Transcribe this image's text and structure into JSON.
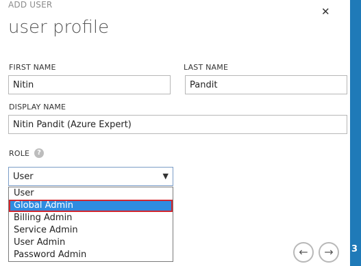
{
  "dialog": {
    "header": "ADD USER",
    "title": "user profile",
    "close_icon": "close-icon"
  },
  "form": {
    "first_name": {
      "label": "FIRST NAME",
      "value": "Nitin"
    },
    "last_name": {
      "label": "LAST NAME",
      "value": "Pandit"
    },
    "display_name": {
      "label": "DISPLAY NAME",
      "value": "Nitin Pandit (Azure Expert)"
    },
    "role": {
      "label": "ROLE",
      "help_icon": "help-icon",
      "selected": "User",
      "options": [
        "User",
        "Global Admin",
        "Billing Admin",
        "Service Admin",
        "User Admin",
        "Password Admin"
      ],
      "highlighted": "Global Admin"
    }
  },
  "navigation": {
    "back_icon": "arrow-left-icon",
    "next_icon": "arrow-right-icon",
    "step": "3"
  },
  "colors": {
    "accent": "#1f7ab8",
    "highlight": "#2f8ce0",
    "highlight_border": "#d2262e"
  }
}
